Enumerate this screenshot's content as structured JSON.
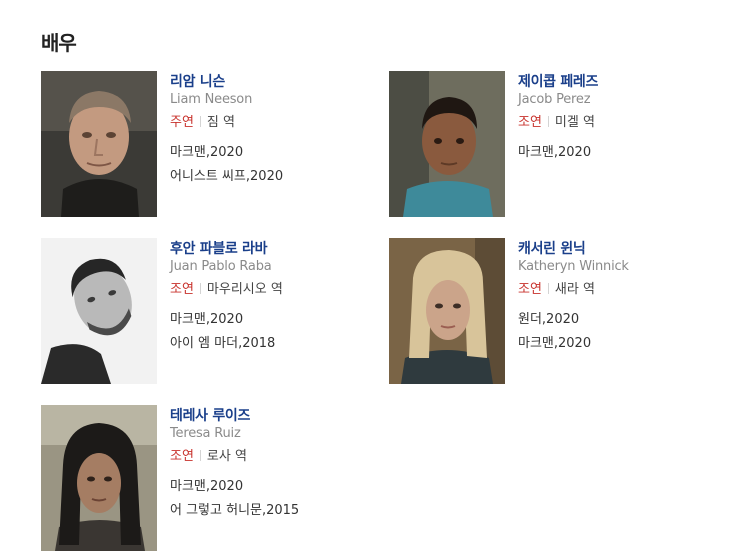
{
  "section": {
    "title": "배우"
  },
  "actors": [
    {
      "name": "리암 니슨",
      "name_en": "Liam Neeson",
      "role_type": "주연",
      "role": "짐 역",
      "films": [
        "마크맨,2020",
        "어니스트 씨프,2020"
      ]
    },
    {
      "name": "제이콥 페레즈",
      "name_en": "Jacob Perez",
      "role_type": "조연",
      "role": "미겔 역",
      "films": [
        "마크맨,2020"
      ]
    },
    {
      "name": "후안 파블로 라바",
      "name_en": "Juan Pablo Raba",
      "role_type": "조연",
      "role": "마우리시오 역",
      "films": [
        "마크맨,2020",
        "아이 엠 마더,2018"
      ]
    },
    {
      "name": "캐서린 윈닉",
      "name_en": "Katheryn Winnick",
      "role_type": "조연",
      "role": "새라 역",
      "films": [
        "원더,2020",
        "마크맨,2020"
      ]
    },
    {
      "name": "테레사 루이즈",
      "name_en": "Teresa Ruiz",
      "role_type": "조연",
      "role": "로사 역",
      "films": [
        "마크맨,2020",
        "어 그렇고 허니문,2015"
      ]
    }
  ]
}
